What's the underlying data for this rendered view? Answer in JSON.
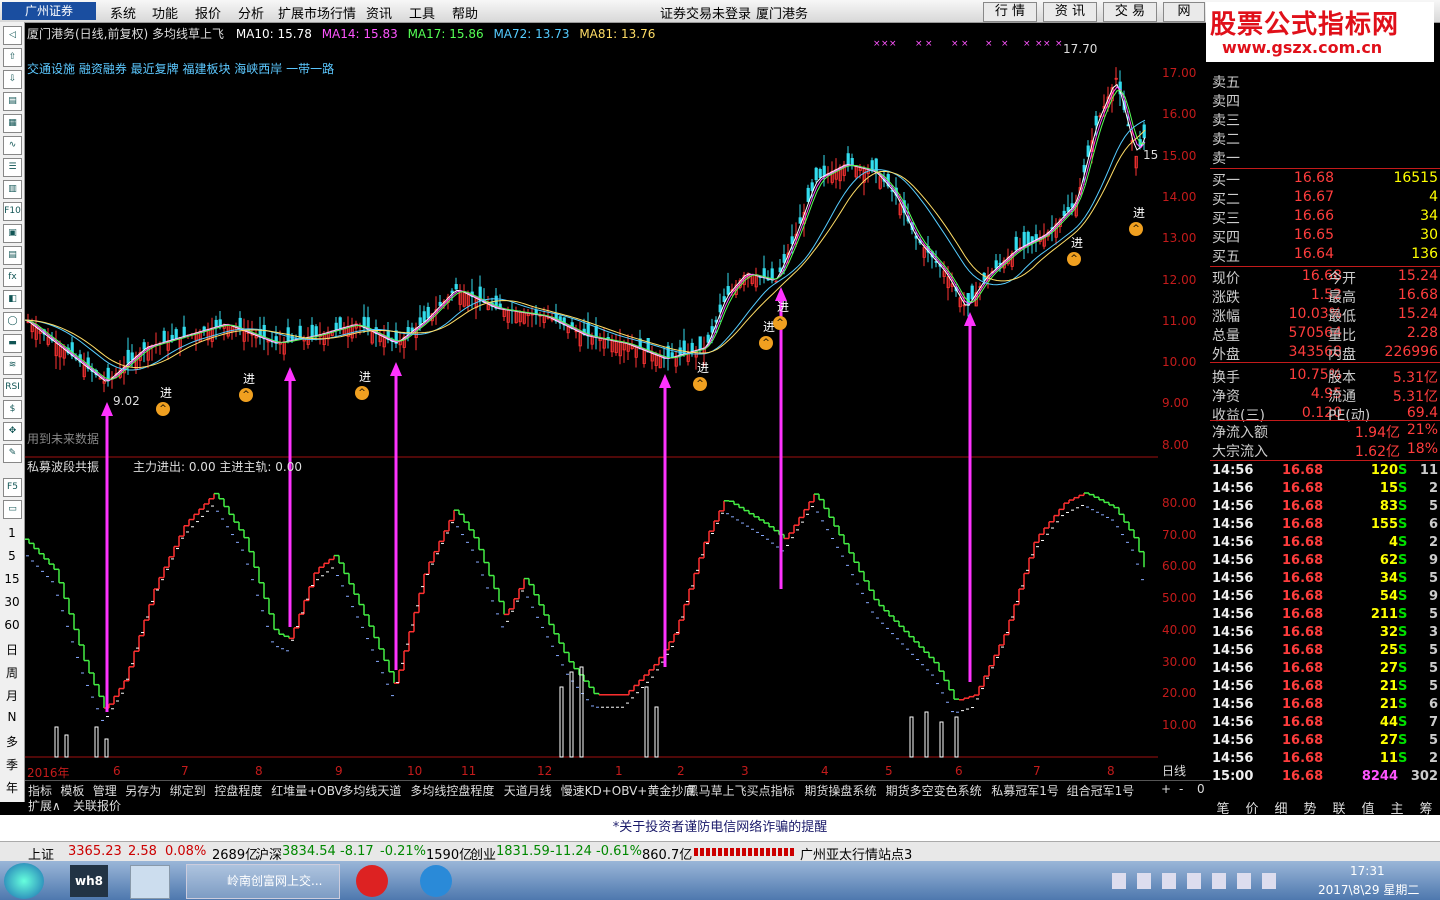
{
  "menubar": {
    "logo": "广州证券",
    "items": [
      "系统",
      "功能",
      "报价",
      "分析",
      "扩展市场行情",
      "资讯",
      "工具",
      "帮助"
    ],
    "center": "证券交易未登录",
    "stock_name": "厦门港务",
    "tabs": [
      "行 情",
      "资 讯",
      "交 易",
      "网"
    ]
  },
  "watermark": {
    "line1": "股票公式指标网",
    "line2": "www.gszx.com.cn"
  },
  "left_toolbar": {
    "periods": [
      "1",
      "5",
      "15",
      "30",
      "60",
      "日",
      "周",
      "月",
      "N",
      "多",
      "季",
      "年"
    ]
  },
  "chart": {
    "title": "厦门港务(日线,前复权) 多均线草上飞",
    "ma": [
      {
        "label": "MA10: 15.78",
        "color": "#ffffff"
      },
      {
        "label": "MA14: 15.83",
        "color": "#ff55ff"
      },
      {
        "label": "MA17: 15.86",
        "color": "#55ff55"
      },
      {
        "label": "MA72: 13.73",
        "color": "#55ccff"
      },
      {
        "label": "MA81: 13.76",
        "color": "#ffdd66"
      }
    ],
    "sectors": "交通设施 融资融券 最近复牌 福建板块 海峡西岸 一带一路",
    "high_label": "17.70",
    "low_label": "9.02",
    "future_note": "用到未来数据",
    "signal_text": "进",
    "right_edge_value": "15",
    "price_axis": [
      "17.00",
      "16.00",
      "15.00",
      "14.00",
      "13.00",
      "12.00",
      "11.00",
      "10.00",
      "9.00",
      "8.00"
    ],
    "indicator_title": "私募波段共振",
    "indicator_values": "主力进出: 0.00  主进主轨: 0.00",
    "ind_axis": [
      "80.00",
      "70.00",
      "60.00",
      "50.00",
      "40.00",
      "30.00",
      "20.00",
      "10.00"
    ],
    "x_labels": [
      "2016年",
      "6",
      "7",
      "8",
      "9",
      "10",
      "11",
      "12",
      "1",
      "2",
      "3",
      "4",
      "5",
      "6",
      "7",
      "8"
    ],
    "period_label": "日线"
  },
  "chart_data": {
    "type": "candlestick",
    "price_range": [
      8.0,
      17.9
    ],
    "high": 17.7,
    "low": 9.02,
    "ma_current": {
      "MA10": 15.78,
      "MA14": 15.83,
      "MA17": 15.86,
      "MA72": 13.73,
      "MA81": 13.76
    },
    "indicator_range": [
      0,
      90
    ]
  },
  "quote": {
    "sell": [
      {
        "label": "卖五"
      },
      {
        "label": "卖四"
      },
      {
        "label": "卖三"
      },
      {
        "label": "卖二"
      },
      {
        "label": "卖一"
      }
    ],
    "buy": [
      {
        "label": "买一",
        "price": "16.68",
        "vol": "16515"
      },
      {
        "label": "买二",
        "price": "16.67",
        "vol": "4"
      },
      {
        "label": "买三",
        "price": "16.66",
        "vol": "34"
      },
      {
        "label": "买四",
        "price": "16.65",
        "vol": "30"
      },
      {
        "label": "买五",
        "price": "16.64",
        "vol": "136"
      }
    ],
    "stats": [
      {
        "l1": "现价",
        "v1": "16.68",
        "l2": "今开",
        "v2": "15.24"
      },
      {
        "l1": "涨跌",
        "v1": "1.52",
        "l2": "最高",
        "v2": "16.68"
      },
      {
        "l1": "涨幅",
        "v1": "10.03%",
        "l2": "最低",
        "v2": "15.24"
      },
      {
        "l1": "总量",
        "v1": "570564",
        "l2": "量比",
        "v2": "2.28"
      },
      {
        "l1": "外盘",
        "v1": "343568",
        "l2": "内盘",
        "v2": "226996"
      },
      {
        "l1": "换手",
        "v1": "10.75%",
        "l2": "股本",
        "v2": "5.31亿"
      },
      {
        "l1": "净资",
        "v1": "4.95",
        "l2": "流通",
        "v2": "5.31亿"
      },
      {
        "l1": "收益(三)",
        "v1": "0.120",
        "l2": "PE(动)",
        "v2": "69.4"
      }
    ],
    "flow": [
      {
        "label": "净流入额",
        "value": "1.94亿",
        "pct": "21%"
      },
      {
        "label": "大宗流入",
        "value": "1.62亿",
        "pct": "18%"
      }
    ]
  },
  "ticks": [
    {
      "t": "14:56",
      "p": "16.68",
      "v": "120",
      "s": "S",
      "n": "11"
    },
    {
      "t": "14:56",
      "p": "16.68",
      "v": "15",
      "s": "S",
      "n": "2"
    },
    {
      "t": "14:56",
      "p": "16.68",
      "v": "83",
      "s": "S",
      "n": "5"
    },
    {
      "t": "14:56",
      "p": "16.68",
      "v": "155",
      "s": "S",
      "n": "6"
    },
    {
      "t": "14:56",
      "p": "16.68",
      "v": "4",
      "s": "S",
      "n": "2"
    },
    {
      "t": "14:56",
      "p": "16.68",
      "v": "62",
      "s": "S",
      "n": "9"
    },
    {
      "t": "14:56",
      "p": "16.68",
      "v": "34",
      "s": "S",
      "n": "5"
    },
    {
      "t": "14:56",
      "p": "16.68",
      "v": "54",
      "s": "S",
      "n": "9"
    },
    {
      "t": "14:56",
      "p": "16.68",
      "v": "211",
      "s": "S",
      "n": "5"
    },
    {
      "t": "14:56",
      "p": "16.68",
      "v": "32",
      "s": "S",
      "n": "3"
    },
    {
      "t": "14:56",
      "p": "16.68",
      "v": "25",
      "s": "S",
      "n": "5"
    },
    {
      "t": "14:56",
      "p": "16.68",
      "v": "27",
      "s": "S",
      "n": "5"
    },
    {
      "t": "14:56",
      "p": "16.68",
      "v": "21",
      "s": "S",
      "n": "5"
    },
    {
      "t": "14:56",
      "p": "16.68",
      "v": "21",
      "s": "S",
      "n": "6"
    },
    {
      "t": "14:56",
      "p": "16.68",
      "v": "44",
      "s": "S",
      "n": "7"
    },
    {
      "t": "14:56",
      "p": "16.68",
      "v": "27",
      "s": "S",
      "n": "5"
    },
    {
      "t": "14:56",
      "p": "16.68",
      "v": "11",
      "s": "S",
      "n": "2"
    },
    {
      "t": "15:00",
      "p": "16.68",
      "v": "8244",
      "s": "",
      "n": "302"
    }
  ],
  "bottom_tabs": [
    "指标",
    "模板",
    "管理",
    "另存为",
    "绑定到",
    "控盘程度",
    "红堆量+OBV",
    "多均线天道",
    "多均线控盘程度",
    "天道月线",
    "慢速KD+OBV+黄金抄底",
    "黑马草上飞买点指标",
    "期货操盘系统",
    "期货多空变色系统",
    "私募冠军1号",
    "组合冠军1号"
  ],
  "bottom_tabs_right": [
    "+",
    "-",
    "0"
  ],
  "bottom_tabs2": [
    "扩展∧",
    "关联报价"
  ],
  "right_tabs": [
    "笔",
    "价",
    "细",
    "势",
    "联",
    "值",
    "主",
    "筹"
  ],
  "notice": "*关于投资者谨防电信网络诈骗的提醒",
  "status": {
    "sh_label": "上证",
    "sh_val": "3365.23",
    "sh_chg": "2.58",
    "sh_pct": "0.08%",
    "sh_amt": "2689亿",
    "sz_label": "沪深",
    "sz_val": "3834.54",
    "sz_chg": "-8.17",
    "sz_pct": "-0.21%",
    "sz_amt": "1590亿",
    "cy_label": "创业",
    "cy_val": "1831.59",
    "cy_chg": "-11.24",
    "cy_pct": "-0.61%",
    "cy_amt": "860.7亿",
    "station": "广州亚太行情站点3"
  },
  "taskbar": {
    "window_title": "岭南创富网上交...",
    "time": "17:31",
    "date": "2017\\8\\29 星期二"
  }
}
